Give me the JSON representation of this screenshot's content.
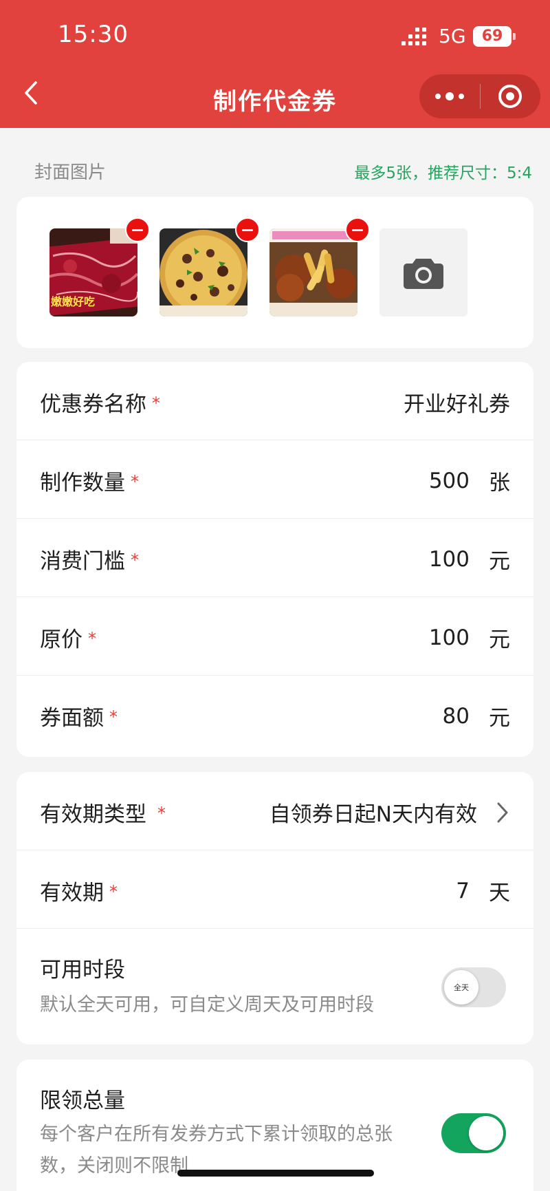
{
  "status_bar": {
    "time": "15:30",
    "network": "5G",
    "battery": "69"
  },
  "header": {
    "title": "制作代金券"
  },
  "cover": {
    "label": "封面图片",
    "hint": "最多5张，推荐尺寸：5:4",
    "images": [
      {
        "caption": "嫩嫩好吃"
      },
      {
        "caption": ""
      },
      {
        "caption": ""
      }
    ]
  },
  "form": {
    "fields": [
      {
        "label": "优惠券名称",
        "required": "*",
        "value": "开业好礼券",
        "unit": ""
      },
      {
        "label": "制作数量",
        "required": "*",
        "value": "500",
        "unit": "张"
      },
      {
        "label": "消费门槛",
        "required": "*",
        "value": "100",
        "unit": "元"
      },
      {
        "label": "原价",
        "required": "*",
        "value": "100",
        "unit": "元"
      },
      {
        "label": "券面额",
        "required": "*",
        "value": "80",
        "unit": "元"
      }
    ]
  },
  "validity": {
    "type_label": "有效期类型",
    "type_required": "*",
    "type_value": "自领券日起N天内有效",
    "period_label": "有效期",
    "period_required": "*",
    "period_value": "7",
    "period_unit": "天",
    "time_label": "可用时段",
    "time_desc": "默认全天可用，可自定义周天及可用时段",
    "time_switch_text": "全天",
    "time_switch_on": false
  },
  "limit": {
    "label": "限领总量",
    "desc_line1": "每个客户在所有发券方式下累计领取的总张",
    "desc_line2": "数，关闭则不限制",
    "switch_on": true
  },
  "colors": {
    "brand": "#e2423d",
    "success": "#13a55d",
    "hint": "#27a360"
  }
}
